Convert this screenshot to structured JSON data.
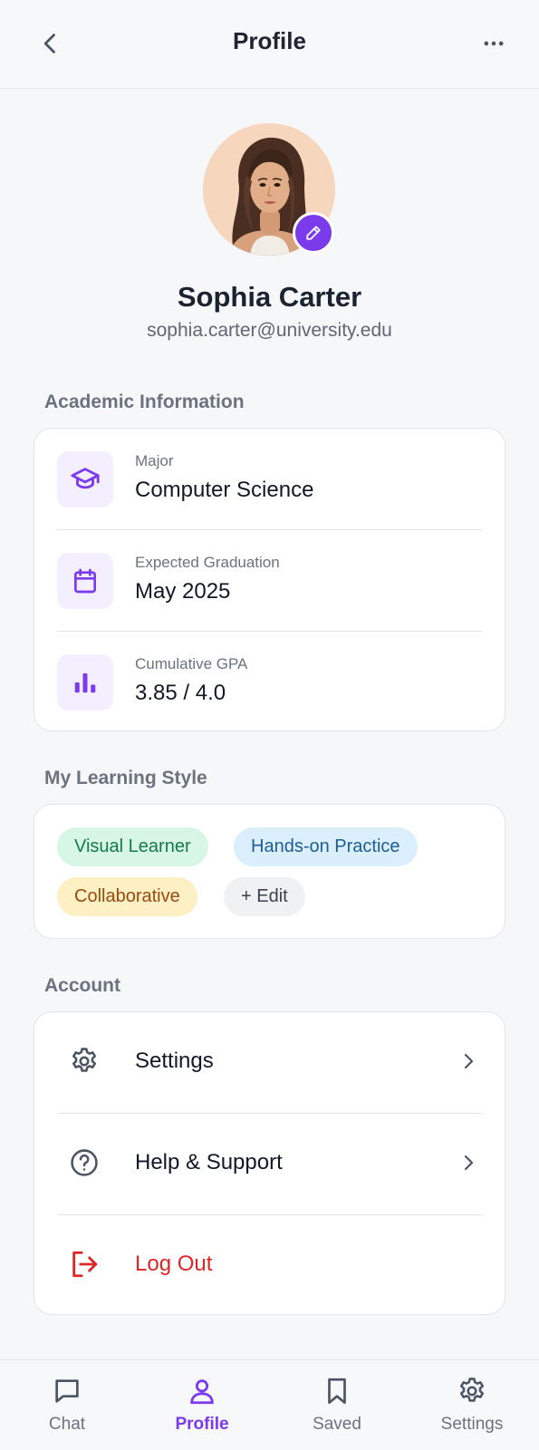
{
  "header": {
    "title": "Profile",
    "back_icon": "chevron-left-icon",
    "more_icon": "more-horizontal-icon"
  },
  "profile": {
    "name": "Sophia Carter",
    "email": "sophia.carter@university.edu",
    "edit_icon": "pencil-icon"
  },
  "academic": {
    "section_title": "Academic Information",
    "items": [
      {
        "label": "Major",
        "value": "Computer Science",
        "icon": "graduation-cap-icon"
      },
      {
        "label": "Expected Graduation",
        "value": "May 2025",
        "icon": "calendar-icon"
      },
      {
        "label": "Cumulative GPA",
        "value": "3.85 / 4.0",
        "icon": "bar-chart-icon"
      }
    ]
  },
  "learning_style": {
    "section_title": "My Learning Style",
    "tags": [
      {
        "label": "Visual Learner",
        "bg": "#d8f6e6",
        "fg": "#157a47"
      },
      {
        "label": "Hands-on Practice",
        "bg": "#dbeefc",
        "fg": "#1b5e93"
      },
      {
        "label": "Collaborative",
        "bg": "#fdf0c4",
        "fg": "#9a4a11"
      }
    ],
    "edit_label": "+ Edit"
  },
  "account": {
    "section_title": "Account",
    "items": [
      {
        "label": "Settings",
        "icon": "gear-icon"
      },
      {
        "label": "Help & Support",
        "icon": "help-circle-icon"
      },
      {
        "label": "Log Out",
        "icon": "logout-icon"
      }
    ]
  },
  "bottom_nav": {
    "items": [
      {
        "label": "Chat",
        "icon": "chat-icon"
      },
      {
        "label": "Profile",
        "icon": "user-icon",
        "active": true
      },
      {
        "label": "Saved",
        "icon": "bookmark-icon"
      },
      {
        "label": "Settings",
        "icon": "gear-icon"
      }
    ]
  },
  "colors": {
    "accent": "#7c3aed",
    "danger": "#dc2626",
    "background": "#f6f7f9",
    "card": "#ffffff"
  }
}
